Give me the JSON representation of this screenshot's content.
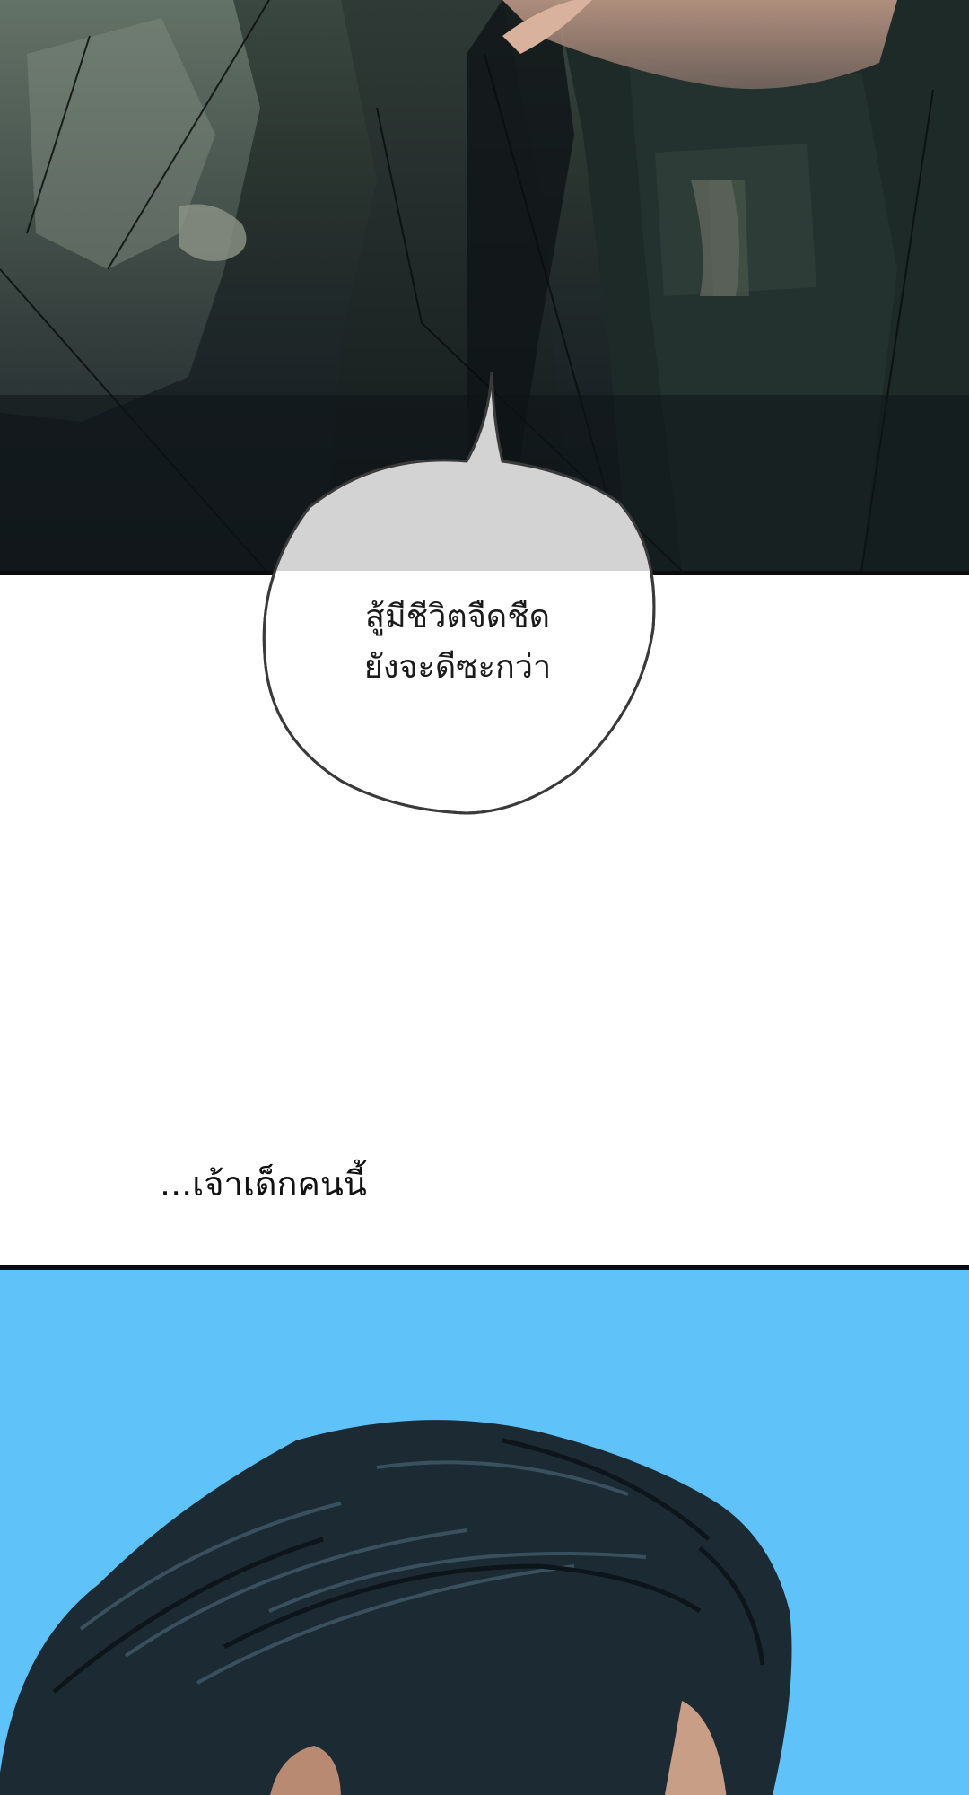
{
  "panels": [
    {
      "name": "dark-scene-panel",
      "background": "#1f2a28"
    },
    {
      "name": "blue-portrait-panel",
      "background": "#5fc3fa"
    }
  ],
  "speech_bubble": {
    "lines": [
      "สู้มีชีวิตจืดชืด",
      "ยังจะดีซะกว่า"
    ]
  },
  "narration": {
    "text": "...เจ้าเด็กคนนี้"
  },
  "colors": {
    "panel_border": "#0b0b0b",
    "sky_blue": "#5fc3fa",
    "hair": "#1c2a33"
  }
}
